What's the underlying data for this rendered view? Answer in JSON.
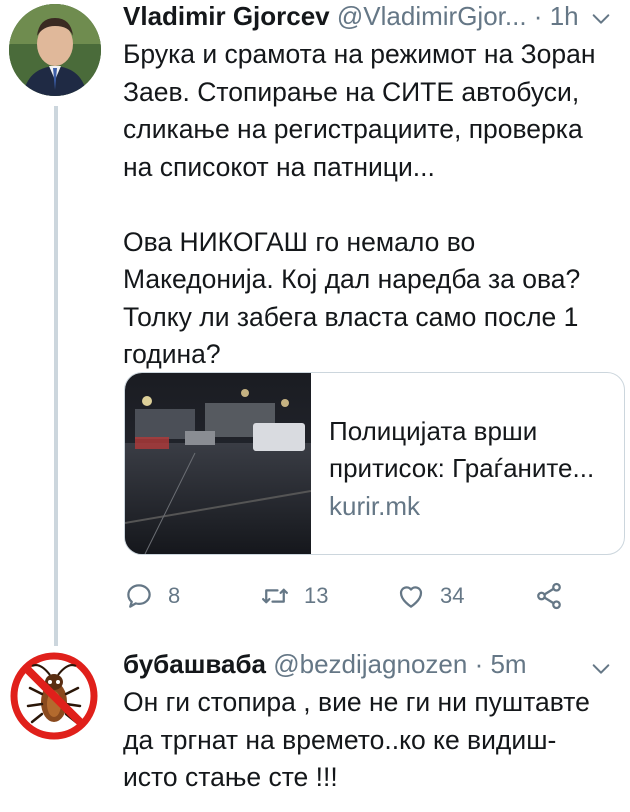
{
  "tweets": [
    {
      "author_name": "Vladimir Gjorcev",
      "handle": "@VladimirGjor...",
      "separator": "·",
      "time": "1h",
      "text": "Брука и срамота на режимот на Зоран Заев. Стопирање на СИТЕ автобуси, сликање на регистрациите, проверка на списокот на патници...\n\nОва НИКОГАШ го немало во Македонија. Кој дал наредба за ова? Толку ли забега власта само после 1 година?",
      "link_card": {
        "title": "Полицијата врши притисок: Граѓаните...",
        "domain": "kurir.mk"
      },
      "actions": {
        "reply_count": "8",
        "retweet_count": "13",
        "like_count": "34"
      }
    },
    {
      "author_name": "бубашваба",
      "handle": "@bezdijagnozen",
      "separator": "·",
      "time": "5m",
      "text": "Он ги стопира , вие не ги ни пуштавте да тргнат на времето..ко ке видиш- исто стање сте !!!"
    }
  ],
  "colors": {
    "text_primary": "#14171a",
    "text_secondary": "#657786",
    "thread_line": "#ccd6dd",
    "icon_gray": "#657786",
    "ban_red": "#e0201b"
  },
  "icons": [
    "chevron-down-icon",
    "reply-icon",
    "retweet-icon",
    "like-icon",
    "share-icon",
    "no-cockroach-icon"
  ]
}
